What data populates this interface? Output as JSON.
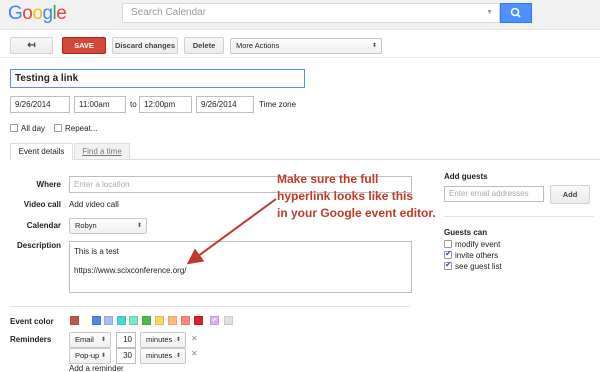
{
  "header": {
    "logo_letters": [
      "G",
      "o",
      "o",
      "g",
      "l",
      "e"
    ],
    "search_placeholder": "Search Calendar"
  },
  "toolbar": {
    "back_label": "↤",
    "save_label": "SAVE",
    "discard_label": "Discard changes",
    "delete_label": "Delete",
    "more_actions": "More Actions"
  },
  "event": {
    "title": "Testing a link",
    "start_date": "9/26/2014",
    "start_time": "11:00am",
    "to_label": "to",
    "end_time": "12:00pm",
    "end_date": "9/26/2014",
    "timezone_link": "Time zone",
    "all_day_label": "All day",
    "repeat_label": "Repeat..."
  },
  "tabs": {
    "details": "Event details",
    "find_time": "Find a time"
  },
  "details": {
    "where_label": "Where",
    "where_placeholder": "Enter a location",
    "video_label": "Video call",
    "video_link": "Add video call",
    "calendar_label": "Calendar",
    "calendar_value": "Robyn",
    "description_label": "Description",
    "description_line1": "This is a test",
    "description_line2": "https://www.scixconference.org/",
    "color_label": "Event color",
    "reminders_label": "Reminders",
    "reminder1_type": "Email",
    "reminder1_value": "10",
    "reminder1_unit": "minutes",
    "reminder2_type": "Pop-up",
    "reminder2_value": "30",
    "reminder2_unit": "minutes",
    "add_reminder": "Add a reminder",
    "colors": [
      "#c0564b",
      "#5484ed",
      "#a4bdfc",
      "#46d6db",
      "#7ae7bf",
      "#51b749",
      "#fbd75b",
      "#ffb878",
      "#ff887c",
      "#dc2127",
      "#dbadff",
      "#e1e1e1"
    ]
  },
  "guests": {
    "add_label": "Add guests",
    "input_placeholder": "Enter email addresses",
    "add_button": "Add",
    "can_label": "Guests can",
    "modify": "modify event",
    "invite": "invite others",
    "see": "see guest list"
  },
  "annotation": {
    "line1": "Make sure the full",
    "line2": "hyperlink looks like this",
    "line3": "in your Google event editor."
  }
}
